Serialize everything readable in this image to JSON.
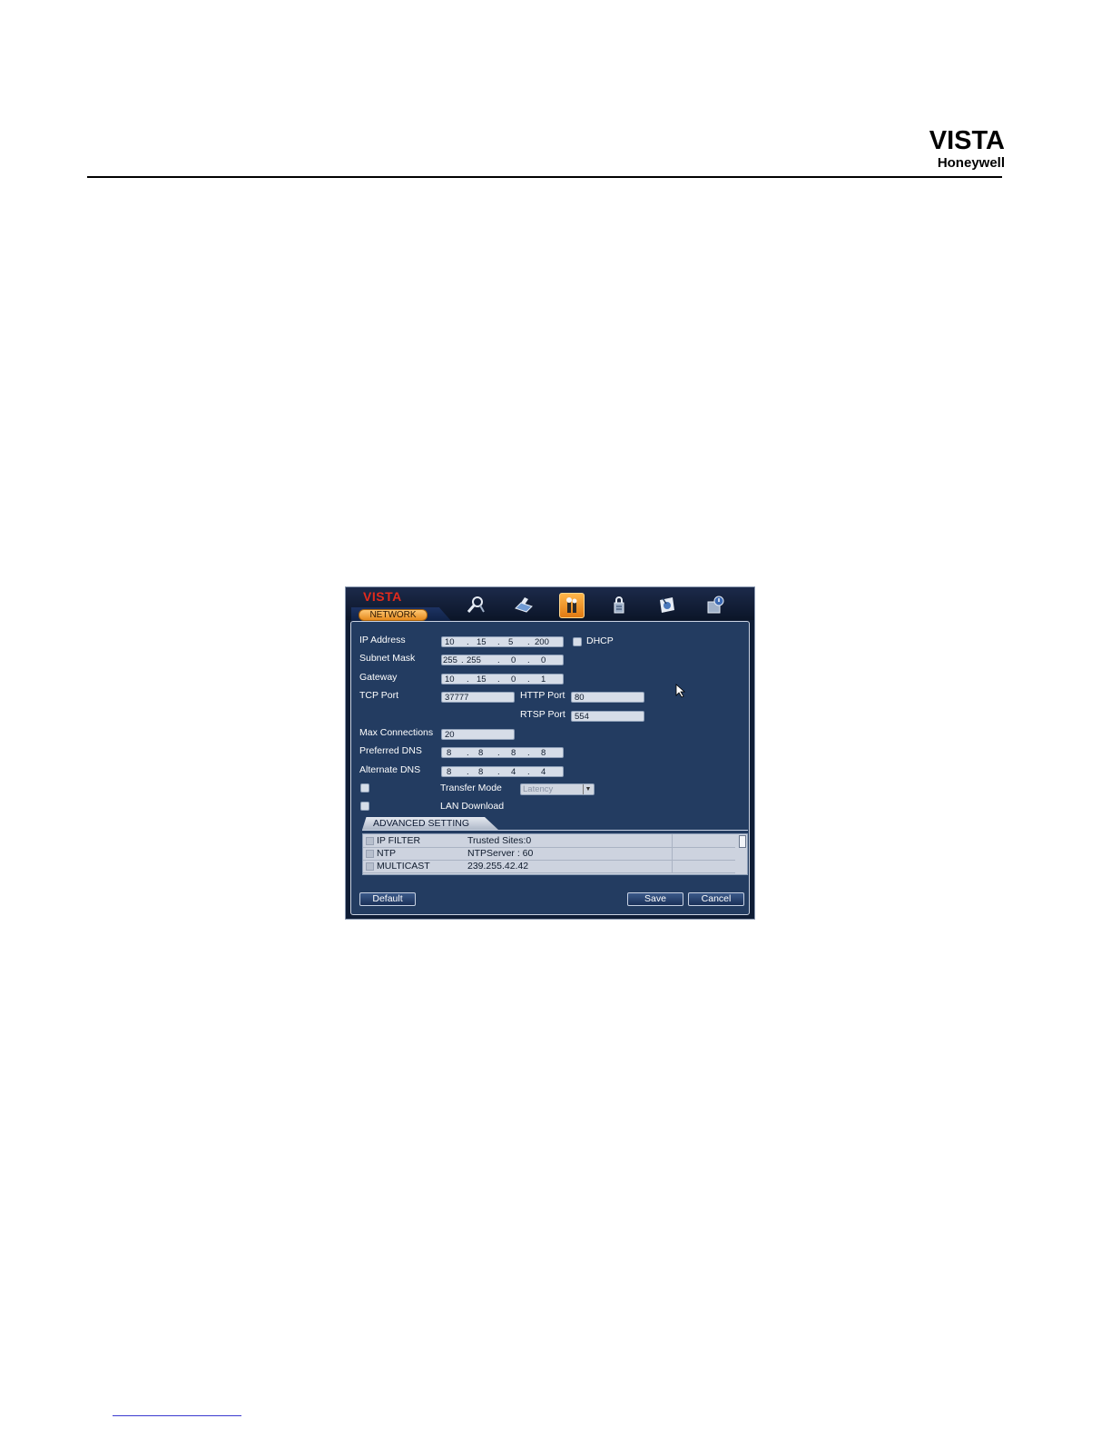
{
  "page": {
    "brand_name": "VISTA",
    "brand_company": "Honeywell"
  },
  "app": {
    "logo": "VISTA",
    "active_tab": "NETWORK",
    "nav_icons": [
      "search-icon",
      "record-icon",
      "tools-icon",
      "account-icon",
      "info-icon",
      "shutdown-icon"
    ],
    "active_icon": "tools-icon"
  },
  "form": {
    "ip_address": {
      "label": "IP Address",
      "octets": [
        "10",
        "15",
        "5",
        "200"
      ]
    },
    "dhcp": {
      "label": "DHCP",
      "checked": false
    },
    "subnet_mask": {
      "label": "Subnet Mask",
      "octets": [
        "255",
        "255",
        "0",
        "0"
      ]
    },
    "gateway": {
      "label": "Gateway",
      "octets": [
        "10",
        "15",
        "0",
        "1"
      ]
    },
    "tcp_port": {
      "label": "TCP Port",
      "value": "37777"
    },
    "http_port": {
      "label": "HTTP Port",
      "value": "80"
    },
    "rtsp_port": {
      "label": "RTSP Port",
      "value": "554"
    },
    "max_connections": {
      "label": "Max Connections",
      "value": "20"
    },
    "preferred_dns": {
      "label": "Preferred DNS",
      "octets": [
        "8",
        "8",
        "8",
        "8"
      ]
    },
    "alternate_dns": {
      "label": "Alternate DNS",
      "octets": [
        "8",
        "8",
        "4",
        "4"
      ]
    },
    "transfer_mode": {
      "label": "Transfer Mode",
      "value": "Latency",
      "checked": false
    },
    "lan_download": {
      "label": "LAN Download",
      "checked": false
    }
  },
  "advanced": {
    "tab_label": "ADVANCED SETTING",
    "rows": [
      {
        "name": "IP FILTER",
        "value": "Trusted Sites:0"
      },
      {
        "name": "NTP",
        "value": "NTPServer : 60"
      },
      {
        "name": "MULTICAST",
        "value": "239.255.42.42"
      }
    ]
  },
  "buttons": {
    "default": "Default",
    "save": "Save",
    "cancel": "Cancel"
  }
}
